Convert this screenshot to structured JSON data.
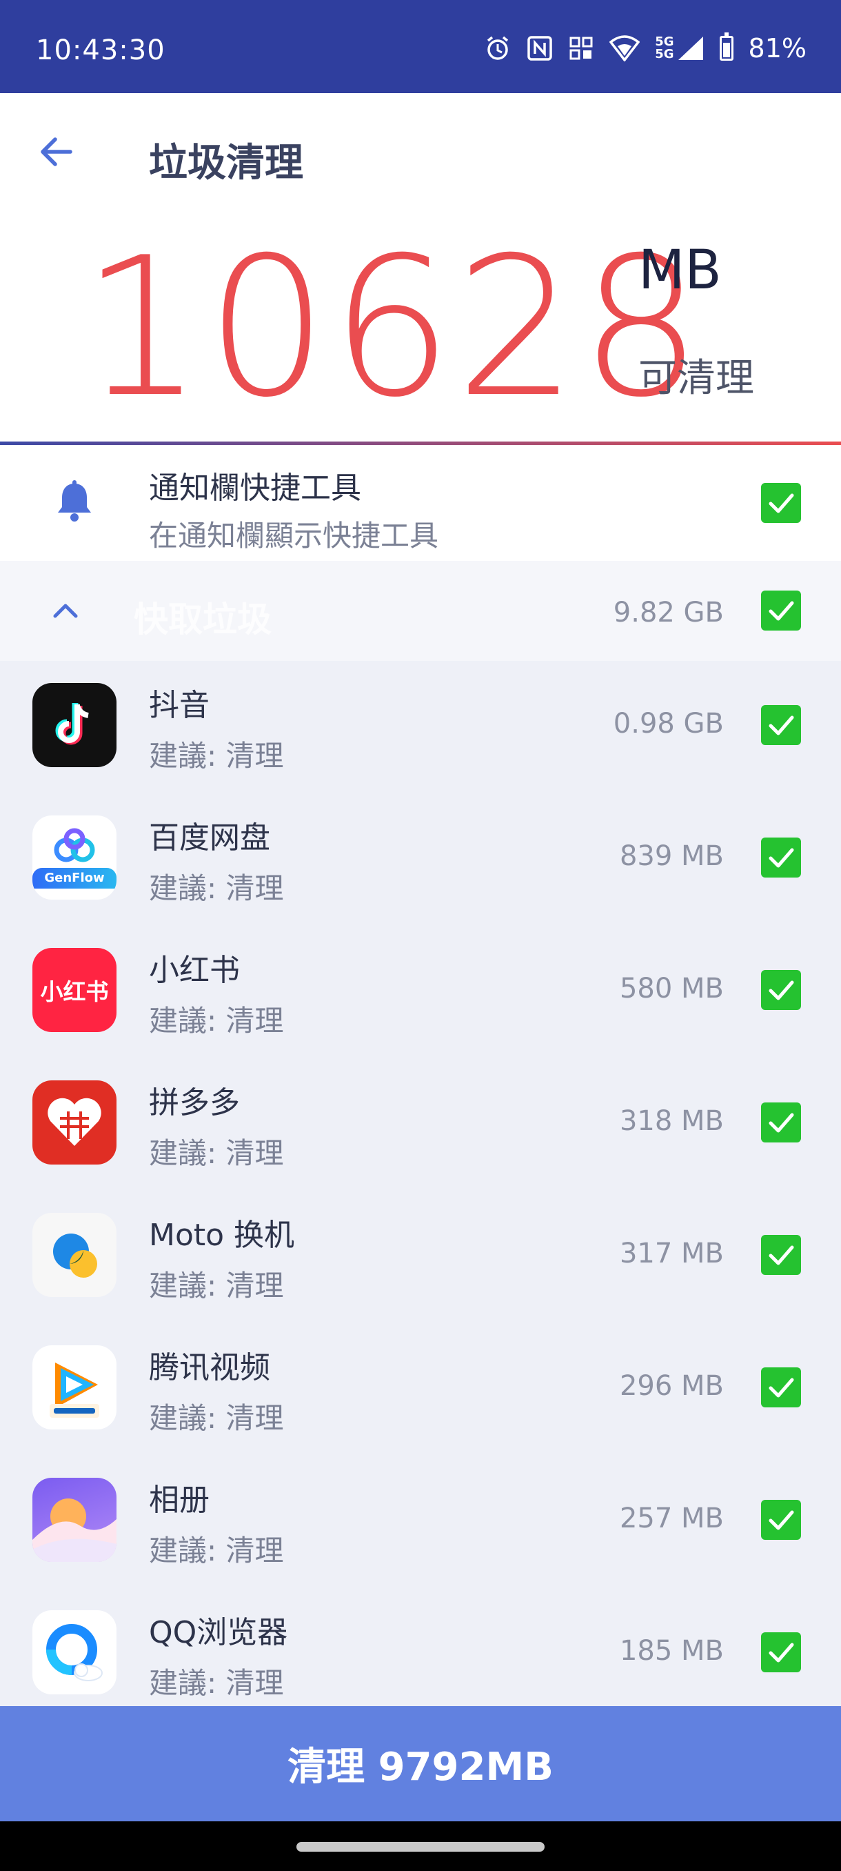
{
  "status_bar": {
    "time": "10:43:30",
    "battery_text": "81%",
    "battery_level": 0.81,
    "network_label": "5G",
    "icons": [
      "alarm-icon",
      "nfc-icon",
      "vibrate-icon",
      "wifi-icon",
      "cellular-5g-icon",
      "battery-icon"
    ]
  },
  "header": {
    "title": "垃圾清理",
    "back_icon": "arrow-left-icon"
  },
  "summary": {
    "amount": "10628",
    "unit": "MB",
    "label": "可清理",
    "amount_color": "#ea4d50"
  },
  "notification": {
    "title": "通知欄快捷工具",
    "subtitle": "在通知欄顯示快捷工具",
    "checked": true
  },
  "section": {
    "label": "快取垃圾",
    "size": "9.82 GB",
    "checked": true
  },
  "apps": [
    {
      "name": "抖音",
      "advice": "建議: 清理",
      "size": "0.98 GB",
      "icon": "douyin-icon",
      "checked": true
    },
    {
      "name": "百度网盘",
      "advice": "建議: 清理",
      "size": "839 MB",
      "icon": "baidu-netdisk-icon",
      "icon_label": "GenFlow",
      "checked": true
    },
    {
      "name": "小红书",
      "advice": "建議: 清理",
      "size": "580 MB",
      "icon": "xiaohongshu-icon",
      "icon_label": "小红书",
      "checked": true
    },
    {
      "name": "拼多多",
      "advice": "建議: 清理",
      "size": "318 MB",
      "icon": "pinduoduo-icon",
      "checked": true
    },
    {
      "name": "Moto 换机",
      "advice": "建議: 清理",
      "size": "317 MB",
      "icon": "moto-migrate-icon",
      "checked": true
    },
    {
      "name": "腾讯视频",
      "advice": "建議: 清理",
      "size": "296 MB",
      "icon": "tencent-video-icon",
      "checked": true
    },
    {
      "name": "相册",
      "advice": "建議: 清理",
      "size": "257 MB",
      "icon": "gallery-icon",
      "checked": true
    },
    {
      "name": "QQ浏览器",
      "advice": "建議: 清理",
      "size": "185 MB",
      "icon": "qq-browser-icon",
      "checked": true
    }
  ],
  "clean_button": {
    "label": "清理 9792MB"
  },
  "colors": {
    "primary": "#2f3e9e",
    "accent": "#6181e0",
    "check": "#25c230"
  }
}
